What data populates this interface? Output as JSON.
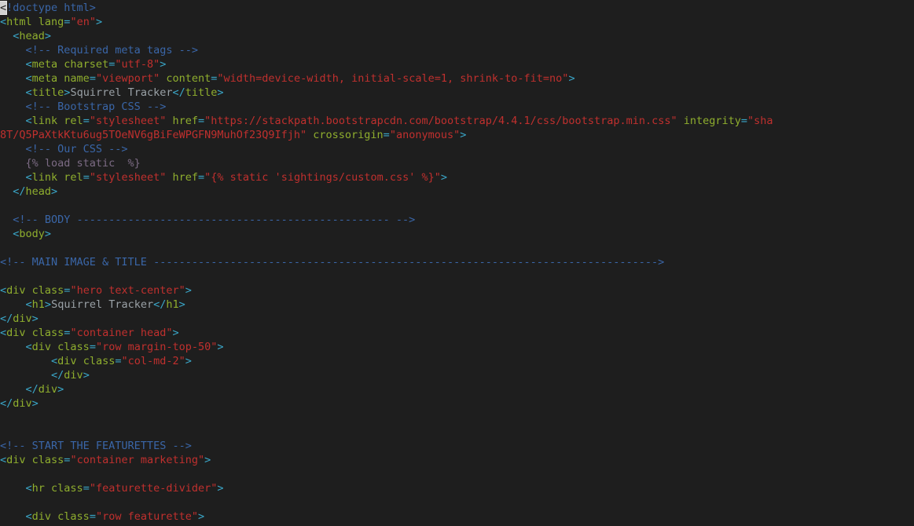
{
  "editor": {
    "lines": [
      [
        [
          "cursor",
          "<"
        ],
        [
          "comment",
          "!doctype html>"
        ]
      ],
      [
        [
          "punc",
          "<"
        ],
        [
          "tag",
          "html "
        ],
        [
          "attr",
          "lang"
        ],
        [
          "punc",
          "="
        ],
        [
          "str",
          "\"en\""
        ],
        [
          "punc",
          ">"
        ]
      ],
      [
        [
          "text",
          "  "
        ],
        [
          "punc",
          "<"
        ],
        [
          "tag",
          "head"
        ],
        [
          "punc",
          ">"
        ]
      ],
      [
        [
          "text",
          "    "
        ],
        [
          "comment",
          "<!-- Required meta tags -->"
        ]
      ],
      [
        [
          "text",
          "    "
        ],
        [
          "punc",
          "<"
        ],
        [
          "tag",
          "meta "
        ],
        [
          "attr",
          "charset"
        ],
        [
          "punc",
          "="
        ],
        [
          "str",
          "\"utf-8\""
        ],
        [
          "punc",
          ">"
        ]
      ],
      [
        [
          "text",
          "    "
        ],
        [
          "punc",
          "<"
        ],
        [
          "tag",
          "meta "
        ],
        [
          "attr",
          "name"
        ],
        [
          "punc",
          "="
        ],
        [
          "str",
          "\"viewport\" "
        ],
        [
          "attr",
          "content"
        ],
        [
          "punc",
          "="
        ],
        [
          "str",
          "\"width=device-width, initial-scale=1, shrink-to-fit=no\""
        ],
        [
          "punc",
          ">"
        ]
      ],
      [
        [
          "text",
          "    "
        ],
        [
          "punc",
          "<"
        ],
        [
          "tag",
          "title"
        ],
        [
          "punc",
          ">"
        ],
        [
          "text",
          "Squirrel Tracker"
        ],
        [
          "punc",
          "</"
        ],
        [
          "tag",
          "title"
        ],
        [
          "punc",
          ">"
        ]
      ],
      [
        [
          "text",
          "    "
        ],
        [
          "comment",
          "<!-- Bootstrap CSS -->"
        ]
      ],
      [
        [
          "text",
          "    "
        ],
        [
          "punc",
          "<"
        ],
        [
          "tag",
          "link "
        ],
        [
          "attr",
          "rel"
        ],
        [
          "punc",
          "="
        ],
        [
          "str",
          "\"stylesheet\" "
        ],
        [
          "attr",
          "href"
        ],
        [
          "punc",
          "="
        ],
        [
          "str",
          "\"https://stackpath.bootstrapcdn.com/bootstrap/4.4.1/css/bootstrap.min.css\" "
        ],
        [
          "attr",
          "integrity"
        ],
        [
          "punc",
          "="
        ],
        [
          "str",
          "\"sha"
        ]
      ],
      [
        [
          "str",
          "8T/Q5PaXtkKtu6ug5TOeNV6gBiFeWPGFN9MuhOf23Q9Ifjh\" "
        ],
        [
          "attr",
          "crossorigin"
        ],
        [
          "punc",
          "="
        ],
        [
          "str",
          "\"anonymous\""
        ],
        [
          "punc",
          ">"
        ]
      ],
      [
        [
          "text",
          "    "
        ],
        [
          "comment",
          "<!-- Our CSS -->"
        ]
      ],
      [
        [
          "text",
          "    "
        ],
        [
          "tpl",
          "{% load static  %}"
        ]
      ],
      [
        [
          "text",
          "    "
        ],
        [
          "punc",
          "<"
        ],
        [
          "tag",
          "link "
        ],
        [
          "attr",
          "rel"
        ],
        [
          "punc",
          "="
        ],
        [
          "str",
          "\"stylesheet\" "
        ],
        [
          "attr",
          "href"
        ],
        [
          "punc",
          "="
        ],
        [
          "str",
          "\"{% static 'sightings/custom.css' %}\""
        ],
        [
          "punc",
          ">"
        ]
      ],
      [
        [
          "text",
          "  "
        ],
        [
          "punc",
          "</"
        ],
        [
          "tag",
          "head"
        ],
        [
          "punc",
          ">"
        ]
      ],
      [],
      [
        [
          "text",
          "  "
        ],
        [
          "comment",
          "<!-- BODY ------------------------------------------------- -->"
        ]
      ],
      [
        [
          "text",
          "  "
        ],
        [
          "punc",
          "<"
        ],
        [
          "tag",
          "body"
        ],
        [
          "punc",
          ">"
        ]
      ],
      [],
      [
        [
          "comment",
          "<!-- MAIN IMAGE & TITLE ------------------------------------------------------------------------------->"
        ]
      ],
      [],
      [
        [
          "punc",
          "<"
        ],
        [
          "tag",
          "div "
        ],
        [
          "attr",
          "class"
        ],
        [
          "punc",
          "="
        ],
        [
          "str",
          "\"hero text-center\""
        ],
        [
          "punc",
          ">"
        ]
      ],
      [
        [
          "text",
          "    "
        ],
        [
          "punc",
          "<"
        ],
        [
          "tag",
          "h1"
        ],
        [
          "punc",
          ">"
        ],
        [
          "text",
          "Squirrel Tracker"
        ],
        [
          "punc",
          "</"
        ],
        [
          "tag",
          "h1"
        ],
        [
          "punc",
          ">"
        ]
      ],
      [
        [
          "punc",
          "</"
        ],
        [
          "tag",
          "div"
        ],
        [
          "punc",
          ">"
        ]
      ],
      [
        [
          "punc",
          "<"
        ],
        [
          "tag",
          "div "
        ],
        [
          "attr",
          "class"
        ],
        [
          "punc",
          "="
        ],
        [
          "str",
          "\"container head\""
        ],
        [
          "punc",
          ">"
        ]
      ],
      [
        [
          "text",
          "    "
        ],
        [
          "punc",
          "<"
        ],
        [
          "tag",
          "div "
        ],
        [
          "attr",
          "class"
        ],
        [
          "punc",
          "="
        ],
        [
          "str",
          "\"row margin-top-50\""
        ],
        [
          "punc",
          ">"
        ]
      ],
      [
        [
          "text",
          "        "
        ],
        [
          "punc",
          "<"
        ],
        [
          "tag",
          "div "
        ],
        [
          "attr",
          "class"
        ],
        [
          "punc",
          "="
        ],
        [
          "str",
          "\"col-md-2\""
        ],
        [
          "punc",
          ">"
        ]
      ],
      [
        [
          "text",
          "        "
        ],
        [
          "punc",
          "</"
        ],
        [
          "tag",
          "div"
        ],
        [
          "punc",
          ">"
        ]
      ],
      [
        [
          "text",
          "    "
        ],
        [
          "punc",
          "</"
        ],
        [
          "tag",
          "div"
        ],
        [
          "punc",
          ">"
        ]
      ],
      [
        [
          "punc",
          "</"
        ],
        [
          "tag",
          "div"
        ],
        [
          "punc",
          ">"
        ]
      ],
      [],
      [],
      [
        [
          "comment",
          "<!-- START THE FEATURETTES -->"
        ]
      ],
      [
        [
          "punc",
          "<"
        ],
        [
          "tag",
          "div "
        ],
        [
          "attr",
          "class"
        ],
        [
          "punc",
          "="
        ],
        [
          "str",
          "\"container marketing\""
        ],
        [
          "punc",
          ">"
        ]
      ],
      [],
      [
        [
          "text",
          "    "
        ],
        [
          "punc",
          "<"
        ],
        [
          "tag",
          "hr "
        ],
        [
          "attr",
          "class"
        ],
        [
          "punc",
          "="
        ],
        [
          "str",
          "\"featurette-divider\""
        ],
        [
          "punc",
          ">"
        ]
      ],
      [],
      [
        [
          "text",
          "    "
        ],
        [
          "punc",
          "<"
        ],
        [
          "tag",
          "div "
        ],
        [
          "attr",
          "class"
        ],
        [
          "punc",
          "="
        ],
        [
          "str",
          "\"row featurette\""
        ],
        [
          "punc",
          ">"
        ]
      ]
    ]
  }
}
